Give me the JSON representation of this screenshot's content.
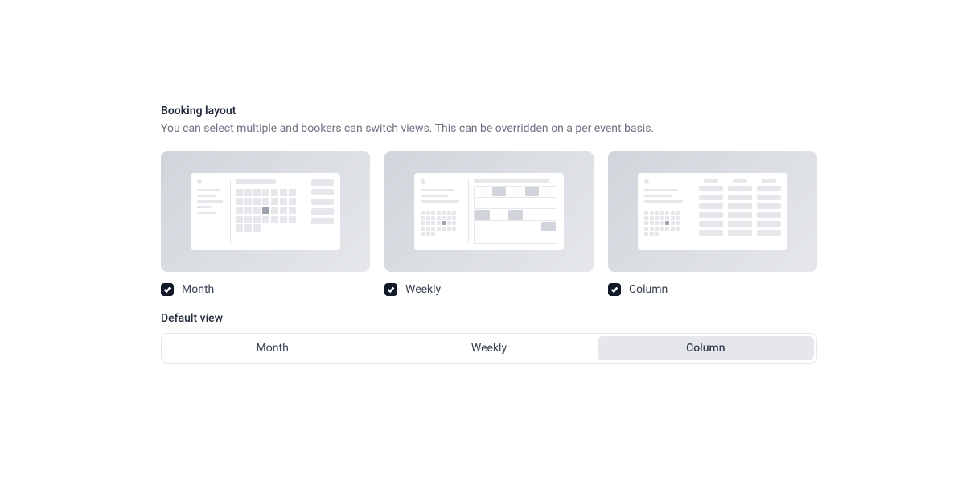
{
  "section": {
    "title": "Booking layout",
    "description": "You can select multiple and bookers can switch views. This can be overridden on a per event basis."
  },
  "layouts": {
    "month": {
      "label": "Month",
      "checked": true
    },
    "weekly": {
      "label": "Weekly",
      "checked": true
    },
    "column": {
      "label": "Column",
      "checked": true
    }
  },
  "defaultView": {
    "label": "Default view",
    "options": {
      "month": "Month",
      "weekly": "Weekly",
      "column": "Column"
    },
    "selected": "column"
  }
}
